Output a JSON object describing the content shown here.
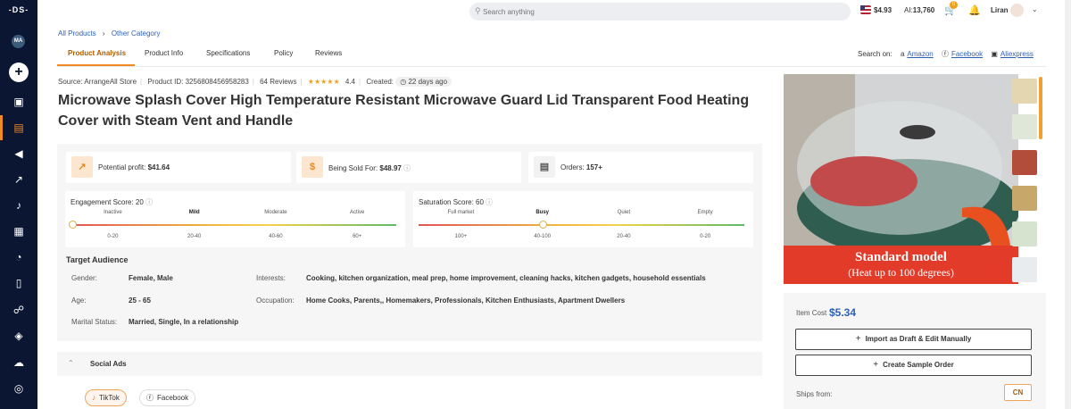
{
  "logo": "-DS-",
  "user_initials": "MA",
  "search": {
    "placeholder": "Search anything"
  },
  "header": {
    "balance": "$4.93",
    "ai_label": "AI:",
    "ai_value": "13,760",
    "cart_count": "0",
    "user_name": "Liran"
  },
  "breadcrumb": [
    "All Products",
    "Other Category"
  ],
  "tabs": [
    "Product Analysis",
    "Product Info",
    "Specifications",
    "Policy",
    "Reviews"
  ],
  "search_on": {
    "label": "Search on:",
    "links": [
      "Amazon",
      "Facebook",
      "Aliexpress"
    ]
  },
  "meta": {
    "source": "Source: ArrangeAll Store",
    "product_id": "Product ID: 3256808456958283",
    "reviews": "64 Reviews",
    "rating": "4.4",
    "created_label": "Created:",
    "created_value": "22 days ago"
  },
  "product_title": "Microwave Splash Cover High Temperature Resistant Microwave Guard Lid Transparent Food Heating Cover with Steam Vent and Handle",
  "cards": {
    "profit_label": "Potential profit:",
    "profit_value": "$41.64",
    "sold_label": "Being Sold For:",
    "sold_value": "$48.97",
    "orders_label": "Orders:",
    "orders_value": "157+"
  },
  "engagement": {
    "title": "Engagement Score: 20",
    "score": 20,
    "levels": [
      "Inactive",
      "Mild",
      "Moderate",
      "Active"
    ],
    "ranges": [
      "0-20",
      "20-40",
      "40-60",
      "60+"
    ]
  },
  "saturation": {
    "title": "Saturation Score: 60",
    "score": 60,
    "levels": [
      "Full market",
      "Busy",
      "Quiet",
      "Empty"
    ],
    "ranges": [
      "100+",
      "40-100",
      "20-40",
      "0-20"
    ]
  },
  "target_audience": {
    "title": "Target Audience",
    "gender_label": "Gender:",
    "gender": "Female, Male",
    "age_label": "Age:",
    "age": "25 - 65",
    "marital_label": "Marital Status:",
    "marital": "Married, Single, In a relationship",
    "interests_label": "Interests:",
    "interests": "Cooking, kitchen organization, meal prep, home improvement, cleaning hacks, kitchen gadgets, household essentials",
    "occupation_label": "Occupation:",
    "occupation": "Home Cooks, Parents,, Homemakers, Professionals, Kitchen Enthusiasts, Apartment Dwellers"
  },
  "social_ads": {
    "title": "Social Ads",
    "chips": [
      "TikTok",
      "Facebook"
    ]
  },
  "image_banner": {
    "line1": "Standard model",
    "line2": "(Heat up to 100 degrees)"
  },
  "right_panel": {
    "cost_label": "Item Cost",
    "cost_value": "$5.34",
    "import_btn": "Import as Draft & Edit Manually",
    "sample_btn": "Create Sample Order",
    "ships_label": "Ships from:",
    "ships_value": "CN"
  }
}
